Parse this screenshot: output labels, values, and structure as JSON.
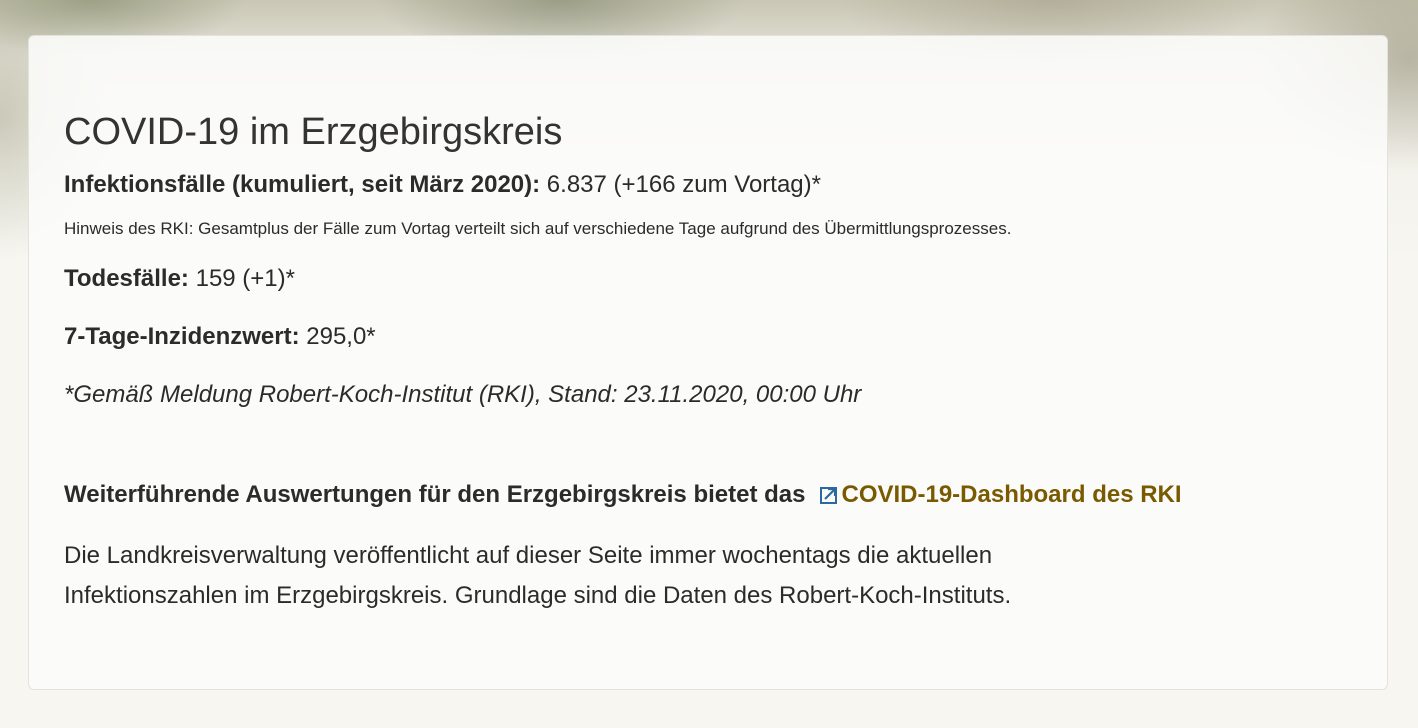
{
  "card": {
    "title": "COVID-19 im Erzgebirgskreis",
    "infections": {
      "label": "Infektionsfälle (kumuliert, seit März 2020):",
      "value": " 6.837 (+166 zum Vortag)*"
    },
    "rki_note": "Hinweis des RKI: Gesamtplus der Fälle zum Vortag verteilt sich auf verschiedene Tage aufgrund des Übermittlungsprozesses.",
    "deaths": {
      "label": "Todesfälle:",
      "value": " 159 (+1)*"
    },
    "incidence": {
      "label": "7-Tage-Inzidenzwert:",
      "value": " 295,0*"
    },
    "source_note": "*Gemäß Meldung Robert-Koch-Institut (RKI), Stand: 23.11.2020, 00:00 Uhr",
    "further": {
      "text": "Weiterführende Auswertungen für den Erzgebirgskreis bietet das",
      "link_label": "COVID-19-Dashboard des RKI",
      "link_icon": "external-link-icon"
    },
    "description": "Die Landkreisverwaltung veröffentlicht auf dieser Seite immer wochentags die aktuellen Infektionszahlen im Erzgebirgskreis. Grundlage sind die Daten des Robert-Koch-Instituts."
  },
  "colors": {
    "link": "#7a5a00",
    "icon": "#2a6aa0",
    "text": "#2b2b2b"
  }
}
